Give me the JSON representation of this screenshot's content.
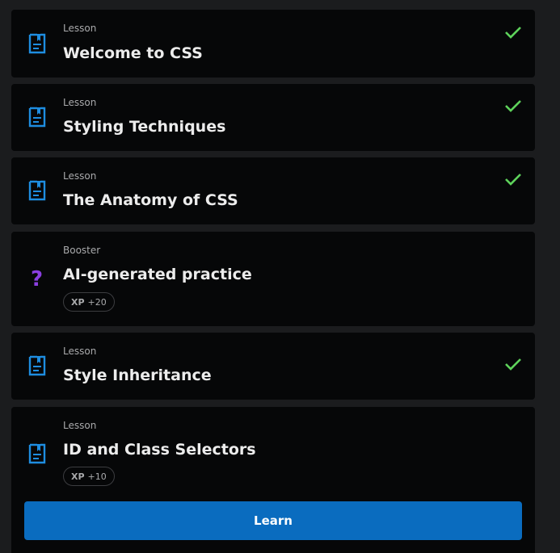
{
  "items": [
    {
      "type": "Lesson",
      "title": "Welcome to CSS",
      "completed": true,
      "icon": "lesson-icon"
    },
    {
      "type": "Lesson",
      "title": "Styling Techniques",
      "completed": true,
      "icon": "lesson-icon"
    },
    {
      "type": "Lesson",
      "title": "The Anatomy of CSS",
      "completed": true,
      "icon": "lesson-icon"
    },
    {
      "type": "Booster",
      "title": "AI-generated practice",
      "completed": false,
      "icon": "question-mark-icon",
      "xp_label": "XP",
      "xp_value": "+20"
    },
    {
      "type": "Lesson",
      "title": "Style Inheritance",
      "completed": true,
      "icon": "lesson-icon"
    },
    {
      "type": "Lesson",
      "title": "ID and Class Selectors",
      "completed": false,
      "icon": "lesson-icon",
      "xp_label": "XP",
      "xp_value": "+10",
      "button_label": "Learn"
    }
  ],
  "colors": {
    "background": "#1b1c1e",
    "card": "#060708",
    "accent_blue": "#0a6cbf",
    "lesson_icon": "#1e8de0",
    "check": "#5ed35b",
    "booster_icon": "#8b3fe0"
  }
}
